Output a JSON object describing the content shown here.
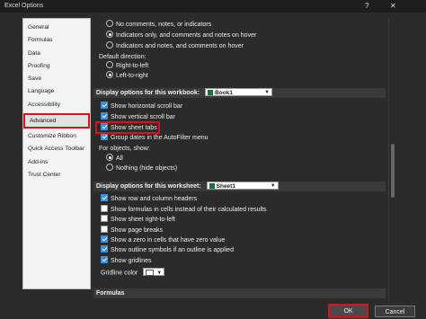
{
  "window": {
    "title": "Excel Options",
    "help": "?",
    "close": "✕"
  },
  "sidebar": {
    "items": [
      {
        "label": "General"
      },
      {
        "label": "Formulas"
      },
      {
        "label": "Data"
      },
      {
        "label": "Proofing"
      },
      {
        "label": "Save"
      },
      {
        "label": "Language"
      },
      {
        "label": "Accessibility"
      },
      {
        "label": "Advanced",
        "selected": true
      },
      {
        "label": "Customize Ribbon"
      },
      {
        "label": "Quick Access Toolbar"
      },
      {
        "label": "Add-ins"
      },
      {
        "label": "Trust Center"
      }
    ]
  },
  "main": {
    "comments": {
      "opt1": "No comments, notes, or indicators",
      "opt2": "Indicators only, and comments and notes on hover",
      "opt3": "Indicators and notes, and comments on hover"
    },
    "direction": {
      "label": "Default direction:",
      "rtl": "Right-to-left",
      "ltr": "Left-to-right"
    },
    "workbook": {
      "header": "Display options for this workbook:",
      "selected": "Book1",
      "opts": [
        {
          "label": "Show horizontal scroll bar",
          "checked": true
        },
        {
          "label": "Show vertical scroll bar",
          "checked": true
        },
        {
          "label": "Show sheet tabs",
          "checked": true
        },
        {
          "label": "Group dates in the AutoFilter menu",
          "checked": true
        }
      ],
      "objects_label": "For objects, show:",
      "all": "All",
      "nothing": "Nothing (hide objects)"
    },
    "worksheet": {
      "header": "Display options for this worksheet:",
      "selected": "Sheet1",
      "opts": [
        {
          "label": "Show row and column headers",
          "checked": true
        },
        {
          "label": "Show formulas in cells instead of their calculated results",
          "checked": false
        },
        {
          "label": "Show sheet right-to-left",
          "checked": false
        },
        {
          "label": "Show page breaks",
          "checked": false
        },
        {
          "label": "Show a zero in cells that have zero value",
          "checked": true
        },
        {
          "label": "Show outline symbols if an outline is applied",
          "checked": true
        },
        {
          "label": "Show gridlines",
          "checked": true
        }
      ],
      "gridline_color_label": "Gridline color"
    },
    "formulas_header": "Formulas"
  },
  "footer": {
    "ok": "OK",
    "cancel": "Cancel"
  }
}
